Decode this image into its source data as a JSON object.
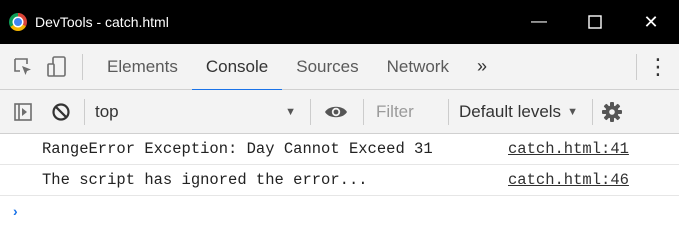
{
  "window": {
    "title": "DevTools - catch.html",
    "minimize_glyph": "—",
    "close_glyph": "✕"
  },
  "tabs": {
    "items": [
      {
        "label": "Elements"
      },
      {
        "label": "Console",
        "active": true
      },
      {
        "label": "Sources"
      },
      {
        "label": "Network"
      }
    ],
    "more": "»",
    "menu": "⋮"
  },
  "toolbar": {
    "context": "top",
    "filter_placeholder": "Filter",
    "levels": "Default levels"
  },
  "console": {
    "messages": [
      {
        "text": "RangeError Exception: Day Cannot Exceed 31",
        "source": "catch.html:41"
      },
      {
        "text": "The script has ignored the error...",
        "source": "catch.html:46"
      }
    ],
    "prompt": "›"
  },
  "colors": {
    "accent": "#1a73e8",
    "titlebar": "#000000",
    "toolbar_bg": "#f3f3f3"
  },
  "icons": [
    "chrome-icon",
    "inspect-element-icon",
    "device-toolbar-icon",
    "sidebar-toggle-icon",
    "clear-console-icon",
    "eye-icon",
    "gear-icon"
  ]
}
